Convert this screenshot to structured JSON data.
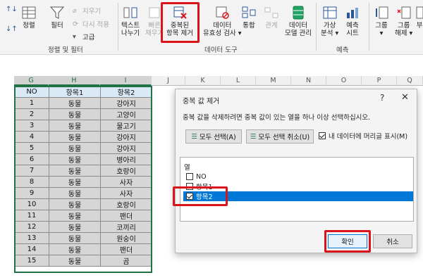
{
  "ribbon": {
    "sort_label": "정렬",
    "filter_label": "필터",
    "clear_label": "지우기",
    "reapply_label": "다시 적용",
    "advanced_label": "고급",
    "sort_filter_group": "정렬 및 필터",
    "text_to_columns": [
      "텍스트",
      "나누기"
    ],
    "flash_fill": [
      "빠른",
      "채우기"
    ],
    "remove_duplicates": [
      "중복된",
      "항목 제거"
    ],
    "data_validation": [
      "데이터",
      "유효성 검사 ▾"
    ],
    "consolidate": "통합",
    "relationships": "관계",
    "data_model": [
      "데이터",
      "모델 관리"
    ],
    "data_tools_group": "데이터 도구",
    "what_if": [
      "가상",
      "분석 ▾"
    ],
    "forecast_sheet": [
      "예측",
      "시트"
    ],
    "forecast_group": "예측",
    "group": [
      "그룹",
      "▾"
    ],
    "ungroup": [
      "그룹",
      "해제 ▾"
    ],
    "subtotal": [
      "부",
      ""
    ]
  },
  "columns": [
    "G",
    "H",
    "I",
    "J",
    "K",
    "L",
    "M",
    "N",
    "O",
    "P",
    "Q"
  ],
  "table": {
    "headers": [
      "NO",
      "항목1",
      "항목2"
    ],
    "rows": [
      [
        "1",
        "동물",
        "강아지"
      ],
      [
        "2",
        "동물",
        "고양이"
      ],
      [
        "3",
        "동물",
        "물고기"
      ],
      [
        "4",
        "동물",
        "강아지"
      ],
      [
        "5",
        "동물",
        "강아지"
      ],
      [
        "6",
        "동물",
        "병아리"
      ],
      [
        "7",
        "동물",
        "호랑이"
      ],
      [
        "8",
        "동물",
        "사자"
      ],
      [
        "9",
        "동물",
        "사자"
      ],
      [
        "10",
        "동물",
        "호랑이"
      ],
      [
        "11",
        "동물",
        "팬더"
      ],
      [
        "12",
        "동물",
        "코끼리"
      ],
      [
        "13",
        "동물",
        "원숭이"
      ],
      [
        "14",
        "동물",
        "팬더"
      ],
      [
        "15",
        "동물",
        "곰"
      ]
    ]
  },
  "dialog": {
    "title": "중복 값 제거",
    "help": "?",
    "close": "✕",
    "description": "중복 값을 삭제하려면 중복 값이 있는 열을 하나 이상 선택하십시오.",
    "select_all": "모두 선택(A)",
    "unselect_all": "모두 선택 취소(U)",
    "has_headers": "내 데이터에 머리글 표시(M)",
    "has_headers_checked": true,
    "list_header": "열",
    "columns": [
      {
        "label": "NO",
        "checked": false
      },
      {
        "label": "항목1",
        "checked": false
      },
      {
        "label": "항목2",
        "checked": true
      }
    ],
    "ok": "확인",
    "cancel": "취소"
  },
  "colors": {
    "highlight": "#d9151b",
    "selection": "#0078d7",
    "excel_green": "#217346"
  }
}
